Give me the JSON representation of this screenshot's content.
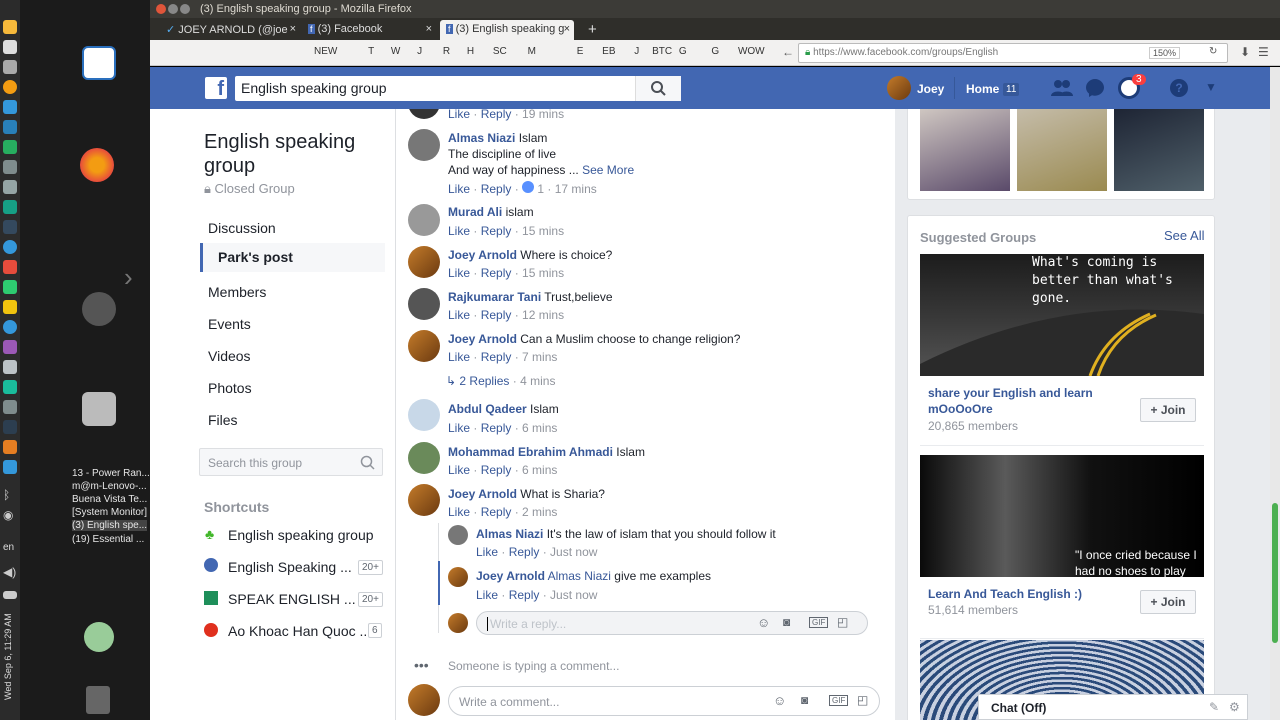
{
  "window": {
    "title": "(3) English speaking group - Mozilla Firefox"
  },
  "tabs": [
    {
      "label": "JOEY ARNOLD (@joe"
    },
    {
      "label": "(3) Facebook"
    },
    {
      "label": "(3) English speaking g"
    }
  ],
  "toolbar": {
    "bookmarks": [
      "NEW",
      "T",
      "W",
      "J",
      "R",
      "H",
      "SC",
      "M",
      "E",
      "EB",
      "J",
      "BTC",
      "G",
      "G",
      "WOW"
    ],
    "url": "https://www.facebook.com/groups/English",
    "zoom": "150%"
  },
  "taskbar": {
    "items": [
      "13 - Power Ran...",
      "m@m-Lenovo-...",
      "Buena Vista Te...",
      "[System Monitor]",
      "(3) English spe...",
      "(19) Essential ..."
    ],
    "lang": "en",
    "clock": "Wed Sep 6, 11:29 AM"
  },
  "fb_header": {
    "search_value": "English speaking group",
    "user": "Joey",
    "home": "Home",
    "home_count": "11",
    "notif_count": "3"
  },
  "group": {
    "title_line1": "English speaking",
    "title_line2": "group",
    "privacy": "Closed Group",
    "nav": [
      "Discussion",
      "Park's post",
      "Members",
      "Events",
      "Videos",
      "Photos",
      "Files"
    ],
    "search_placeholder": "Search this group",
    "shortcuts_heading": "Shortcuts",
    "shortcuts": [
      {
        "label": "English speaking group",
        "badge": ""
      },
      {
        "label": "English Speaking ...",
        "badge": "20+"
      },
      {
        "label": "SPEAK ENGLISH ...",
        "badge": "20+"
      },
      {
        "label": "Ao Khoac Han Quoc ...",
        "badge": "6"
      }
    ]
  },
  "comments": {
    "top_meta": {
      "like": "Like",
      "reply": "Reply",
      "time": "19 mins"
    },
    "list": [
      {
        "name": "Almas Niazi",
        "text": "Islam",
        "line2": "The discipline of live",
        "line3": "And way of happiness ...",
        "see_more": "See More",
        "reactions": "1",
        "time": "17 mins"
      },
      {
        "name": "Murad Ali",
        "text": "islam",
        "time": "15 mins"
      },
      {
        "name": "Joey Arnold",
        "text": "Where is choice?",
        "time": "15 mins"
      },
      {
        "name": "Rajkumarar Tani",
        "text": "Trust,believe",
        "time": "12 mins"
      },
      {
        "name": "Joey Arnold",
        "text": "Can a Muslim choose to change religion?",
        "time": "7 mins"
      },
      {
        "name": "Abdul Qadeer",
        "text": "Islam",
        "time": "6 mins"
      },
      {
        "name": "Mohammad Ebrahim Ahmadi",
        "text": "Islam",
        "time": "6 mins"
      },
      {
        "name": "Joey Arnold",
        "text": "What is Sharia?",
        "time": "2 mins"
      }
    ],
    "replies_link": "2 Replies",
    "replies_time": "4 mins",
    "replies": [
      {
        "name": "Almas Niazi",
        "text": "It's the law of islam that you should follow it",
        "time": "Just now"
      },
      {
        "name": "Joey Arnold",
        "mention": "Almas Niazi",
        "text": "give me examples",
        "time": "Just now"
      }
    ],
    "like_label": "Like",
    "reply_label": "Reply",
    "reply_placeholder": "Write a reply...",
    "typing": "Someone is typing a comment...",
    "comment_placeholder": "Write a comment..."
  },
  "suggested": {
    "heading": "Suggested Groups",
    "see_all": "See All",
    "groups": [
      {
        "image_text": "What's coming is better than what's gone.",
        "name": "share your English and learn mOoOoOre",
        "members": "20,865 members",
        "join": "Join"
      },
      {
        "image_text": "\"I once cried because I had no shoes to play football with my",
        "name": "Learn And Teach English :)",
        "members": "51,614 members",
        "join": "Join"
      }
    ]
  },
  "chat": {
    "label": "Chat (Off)"
  },
  "colors": {
    "fb_blue": "#4267b2",
    "link": "#385898",
    "meta": "#90949c"
  }
}
